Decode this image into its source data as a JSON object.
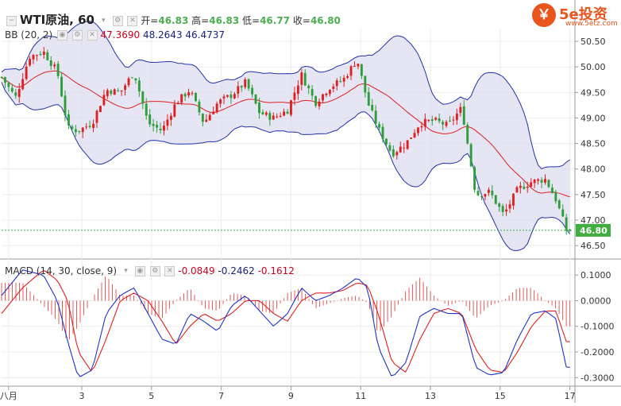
{
  "header": {
    "symbol_title": "WTI原油, 60",
    "ohlc": [
      {
        "label": "开=",
        "value": "46.83"
      },
      {
        "label": "高=",
        "value": "46.83"
      },
      {
        "label": "低=",
        "value": "46.77"
      },
      {
        "label": "收=",
        "value": "46.80"
      }
    ],
    "bb_label": "BB (20, 2)",
    "bb_values": [
      "47.3690",
      "48.2643",
      "46.4737"
    ],
    "macd_label": "MACD (14, 30, close, 9)",
    "macd_values": [
      "-0.0849",
      "-0.2462",
      "-0.1612"
    ],
    "last_price_tag": "46.80"
  },
  "logo": {
    "symbol": "￥",
    "text": "5e投资",
    "url": "www.5etz.com"
  },
  "colors": {
    "up": "#e02020",
    "down": "#2e9e3a",
    "bb_band_fill": "#dcdcef",
    "bb_band_line": "#2233aa",
    "bb_mid": "#e02020",
    "macd_line": "#2233cc",
    "signal_line": "#e02020",
    "last_price_tag": "#3fae3f"
  },
  "chart_data": [
    {
      "type": "candlestick",
      "title": "WTI原油, 60",
      "ylim": [
        46.3,
        50.75
      ],
      "y_ticks": [
        "50.50",
        "50.00",
        "49.50",
        "49.00",
        "48.50",
        "48.00",
        "47.50",
        "47.00",
        "46.50"
      ],
      "x_ticks": [
        "八月",
        "3",
        "5",
        "7",
        "9",
        "11",
        "13",
        "15",
        "17"
      ],
      "last_price": 46.8,
      "grid": true,
      "bb_latest": {
        "middle": 47.369,
        "upper": 48.2643,
        "lower": 46.4737
      },
      "close_path": [
        [
          0,
          49.8
        ],
        [
          2,
          49.4
        ],
        [
          4,
          50.2
        ],
        [
          6,
          50.3
        ],
        [
          8,
          49.9
        ],
        [
          9.5,
          48.8
        ],
        [
          11,
          48.75
        ],
        [
          13,
          48.9
        ],
        [
          15,
          49.55
        ],
        [
          17,
          49.5
        ],
        [
          19,
          49.9
        ],
        [
          21,
          48.9
        ],
        [
          23,
          48.75
        ],
        [
          25,
          49.3
        ],
        [
          27,
          49.55
        ],
        [
          29,
          48.9
        ],
        [
          31,
          49.3
        ],
        [
          33,
          49.45
        ],
        [
          35,
          49.7
        ],
        [
          37,
          49.1
        ],
        [
          39,
          49.0
        ],
        [
          41,
          49.15
        ],
        [
          43,
          49.85
        ],
        [
          45,
          49.3
        ],
        [
          47,
          49.6
        ],
        [
          49,
          49.75
        ],
        [
          51,
          50.15
        ],
        [
          52.5,
          49.3
        ],
        [
          54,
          48.8
        ],
        [
          56,
          48.3
        ],
        [
          58,
          48.5
        ],
        [
          60,
          48.9
        ],
        [
          62,
          48.95
        ],
        [
          64,
          48.85
        ],
        [
          66,
          49.2
        ],
        [
          68,
          47.5
        ],
        [
          70,
          47.55
        ],
        [
          72,
          47.1
        ],
        [
          74,
          47.6
        ],
        [
          76,
          47.75
        ],
        [
          78,
          47.8
        ],
        [
          79.5,
          47.4
        ],
        [
          81,
          46.8
        ]
      ]
    },
    {
      "type": "line",
      "title": "MACD (14, 30, close, 9)",
      "ylim": [
        -0.33,
        0.15
      ],
      "y_ticks": [
        "0.1000",
        "0.0000",
        "-0.1000",
        "-0.2000",
        "-0.3000"
      ],
      "x_ticks": [
        "八月",
        "3",
        "5",
        "7",
        "9",
        "11",
        "13",
        "15",
        "17"
      ],
      "series": [
        {
          "values": [
            [
              0,
              0.02
            ],
            [
              3,
              0.12
            ],
            [
              6,
              0.1
            ],
            [
              8,
              0.0
            ],
            [
              9.5,
              -0.16
            ],
            [
              11,
              -0.3
            ],
            [
              13,
              -0.27
            ],
            [
              15,
              -0.05
            ],
            [
              17,
              0.02
            ],
            [
              19,
              0.05
            ],
            [
              21,
              -0.05
            ],
            [
              23,
              -0.15
            ],
            [
              25,
              -0.17
            ],
            [
              27,
              -0.05
            ],
            [
              29,
              -0.08
            ],
            [
              31,
              -0.12
            ],
            [
              33,
              -0.02
            ],
            [
              35,
              0.02
            ],
            [
              37,
              -0.04
            ],
            [
              39,
              -0.1
            ],
            [
              41,
              -0.05
            ],
            [
              43,
              0.05
            ],
            [
              45,
              0.0
            ],
            [
              47,
              0.02
            ],
            [
              49,
              0.05
            ],
            [
              51,
              0.09
            ],
            [
              52.5,
              0.05
            ],
            [
              54,
              -0.18
            ],
            [
              56,
              -0.3
            ],
            [
              58,
              -0.24
            ],
            [
              60,
              -0.06
            ],
            [
              62,
              -0.03
            ],
            [
              64,
              -0.05
            ],
            [
              66,
              -0.05
            ],
            [
              68,
              -0.26
            ],
            [
              70,
              -0.29
            ],
            [
              72,
              -0.28
            ],
            [
              74,
              -0.15
            ],
            [
              76,
              -0.05
            ],
            [
              78,
              -0.04
            ],
            [
              79.5,
              -0.07
            ],
            [
              81,
              -0.26
            ]
          ]
        },
        {
          "values": [
            [
              0,
              -0.05
            ],
            [
              3,
              0.05
            ],
            [
              6,
              0.12
            ],
            [
              8,
              0.08
            ],
            [
              9.5,
              0.0
            ],
            [
              11,
              -0.2
            ],
            [
              13,
              -0.28
            ],
            [
              15,
              -0.15
            ],
            [
              17,
              0.0
            ],
            [
              19,
              0.03
            ],
            [
              21,
              0.0
            ],
            [
              23,
              -0.08
            ],
            [
              25,
              -0.17
            ],
            [
              27,
              -0.1
            ],
            [
              29,
              -0.05
            ],
            [
              31,
              -0.08
            ],
            [
              33,
              -0.05
            ],
            [
              35,
              0.0
            ],
            [
              37,
              0.0
            ],
            [
              39,
              -0.05
            ],
            [
              41,
              -0.08
            ],
            [
              43,
              0.0
            ],
            [
              45,
              0.03
            ],
            [
              47,
              0.03
            ],
            [
              49,
              0.04
            ],
            [
              51,
              0.07
            ],
            [
              52.5,
              0.06
            ],
            [
              54,
              -0.05
            ],
            [
              56,
              -0.24
            ],
            [
              58,
              -0.28
            ],
            [
              60,
              -0.15
            ],
            [
              62,
              -0.05
            ],
            [
              64,
              -0.03
            ],
            [
              66,
              -0.05
            ],
            [
              68,
              -0.19
            ],
            [
              70,
              -0.27
            ],
            [
              72,
              -0.28
            ],
            [
              74,
              -0.2
            ],
            [
              76,
              -0.1
            ],
            [
              78,
              -0.04
            ],
            [
              79.5,
              -0.04
            ],
            [
              81,
              -0.16
            ]
          ]
        }
      ],
      "histogram_sign_note": "histogram = macd - signal"
    }
  ]
}
